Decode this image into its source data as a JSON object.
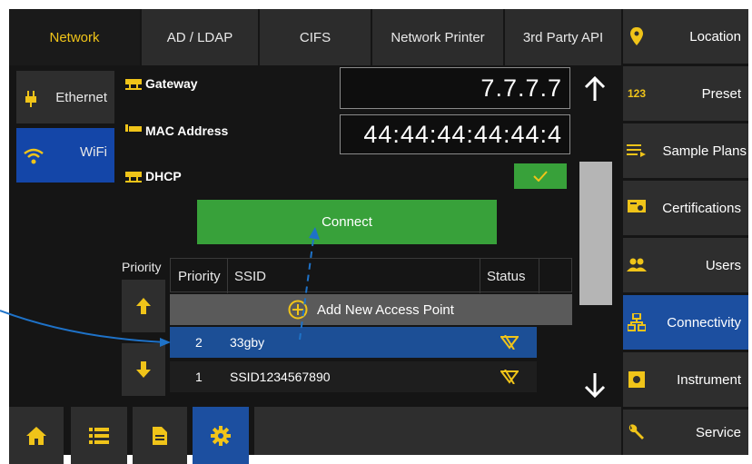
{
  "tabs": [
    {
      "label": "Network",
      "active": true
    },
    {
      "label": "AD / LDAP"
    },
    {
      "label": "CIFS"
    },
    {
      "label": "Network Printer"
    },
    {
      "label": "3rd Party API"
    }
  ],
  "left_nav": {
    "ethernet": "Ethernet",
    "wifi": "WiFi"
  },
  "fields": {
    "gateway_label": "Gateway",
    "gateway_value": "7.7.7.7",
    "mac_label": "MAC Address",
    "mac_value": "44:44:44:44:44:4",
    "dhcp_label": "DHCP",
    "dhcp_checked": true
  },
  "connect_label": "Connect",
  "priority_label": "Priority",
  "table": {
    "headers": [
      "Priority",
      "SSID",
      "Status"
    ],
    "add_label": "Add New Access Point",
    "rows": [
      {
        "priority": "2",
        "ssid": "33gby",
        "selected": true
      },
      {
        "priority": "1",
        "ssid": "SSID1234567890",
        "selected": false
      }
    ]
  },
  "right_nav": [
    {
      "label": "Location",
      "icon": "location-pin-icon"
    },
    {
      "label": "Preset",
      "icon": "123-icon"
    },
    {
      "label": "Sample Plans",
      "icon": "list-arrow-icon"
    },
    {
      "label": "Certifications",
      "icon": "certificate-icon"
    },
    {
      "label": "Users",
      "icon": "users-icon"
    },
    {
      "label": "Connectivity",
      "icon": "network-icon",
      "active": true
    },
    {
      "label": "Instrument",
      "icon": "instrument-icon"
    },
    {
      "label": "Service",
      "icon": "wrench-icon"
    }
  ],
  "bottom_bar": [
    "home-icon",
    "list-icon",
    "document-icon",
    "settings-gear-icon"
  ],
  "colors": {
    "accent_yellow": "#f0c419",
    "active_blue": "#1c4fa0",
    "connect_green": "#38a13a",
    "selected_row": "#1c4f96",
    "wifi_bg": "#1446a8"
  }
}
